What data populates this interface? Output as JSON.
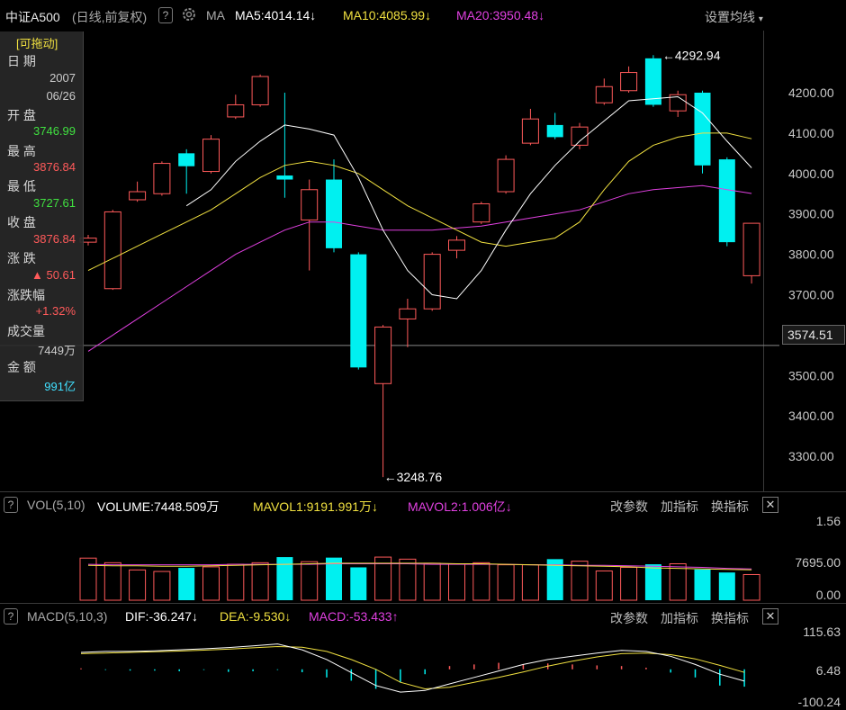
{
  "header": {
    "title": "中证A500",
    "period": "(日线,前复权)",
    "help": "?",
    "ma_label": "MA",
    "ma5": "MA5:4014.14",
    "ma10": "MA10:4085.99",
    "ma20": "MA20:3950.48",
    "settings": "设置均线",
    "colors": {
      "ma5": "#ffffff",
      "ma10": "#f0e040",
      "ma20": "#e040e0"
    }
  },
  "info_panel": {
    "drag": "[可拖动]",
    "date_label": "日 期",
    "year": "2007",
    "date": "06/26",
    "open_label": "开 盘",
    "open": "3746.99",
    "high_label": "最 高",
    "high": "3876.84",
    "low_label": "最 低",
    "low": "3727.61",
    "close_label": "收 盘",
    "close": "3876.84",
    "change_label": "涨 跌",
    "change": "▲ 50.61",
    "pct_label": "涨跌幅",
    "pct": "+1.32%",
    "volume_label": "成交量",
    "volume": "7449万",
    "amount_label": "金 额",
    "amount": "991亿"
  },
  "price_axis": [
    "4200.00",
    "4100.00",
    "4000.00",
    "3900.00",
    "3800.00",
    "3700.00",
    "3500.00",
    "3400.00",
    "3300.00"
  ],
  "crosshair_price": "3574.51",
  "high_marker": "4292.94",
  "low_marker": "3248.76",
  "vol_panel": {
    "name": "VOL(5,10)",
    "volume": "VOLUME:7448.509万",
    "mavol1": "MAVOL1:9191.991万",
    "mavol2": "MAVOL2:1.006亿",
    "axis": [
      "1.56",
      "7695.00",
      "0.00"
    ]
  },
  "macd_panel": {
    "name": "MACD(5,10,3)",
    "dif": "DIF:-36.247",
    "dea": "DEA:-9.530",
    "macd": "MACD:-53.433",
    "axis": [
      "115.63",
      "6.48",
      "-100.24"
    ]
  },
  "panel_buttons": {
    "params": "改参数",
    "add": "加指标",
    "swap": "换指标",
    "close": "✕"
  },
  "arrows": {
    "down": "↓",
    "up": "↑"
  },
  "colors": {
    "up": "#ff5a5a",
    "down": "#00f0f0",
    "dif": "#ffffff",
    "dea": "#f0e040",
    "macd": "#e040e0"
  },
  "chart_data": {
    "type": "candlestick",
    "candles": [
      {
        "o": 3830,
        "c": 3840,
        "h": 3848,
        "l": 3822
      },
      {
        "o": 3715,
        "c": 3905,
        "h": 3910,
        "l": 3712
      },
      {
        "o": 3935,
        "c": 3955,
        "h": 3980,
        "l": 3930
      },
      {
        "o": 3950,
        "c": 4025,
        "h": 4030,
        "l": 3945
      },
      {
        "o": 4050,
        "c": 4018,
        "h": 4060,
        "l": 3950
      },
      {
        "o": 4005,
        "c": 4085,
        "h": 4095,
        "l": 4000
      },
      {
        "o": 4140,
        "c": 4170,
        "h": 4195,
        "l": 4135
      },
      {
        "o": 4170,
        "c": 4240,
        "h": 4245,
        "l": 4165
      },
      {
        "o": 3995,
        "c": 3985,
        "h": 4200,
        "l": 3940
      },
      {
        "o": 3885,
        "c": 3960,
        "h": 3985,
        "l": 3760
      },
      {
        "o": 3985,
        "c": 3815,
        "h": 4035,
        "l": 3805
      },
      {
        "o": 3800,
        "c": 3520,
        "h": 3805,
        "l": 3515
      },
      {
        "o": 3480,
        "c": 3620,
        "h": 3625,
        "l": 3248.76
      },
      {
        "o": 3640,
        "c": 3665,
        "h": 3690,
        "l": 3570
      },
      {
        "o": 3665,
        "c": 3800,
        "h": 3805,
        "l": 3660
      },
      {
        "o": 3810,
        "c": 3835,
        "h": 3845,
        "l": 3790
      },
      {
        "o": 3880,
        "c": 3925,
        "h": 3930,
        "l": 3875
      },
      {
        "o": 3955,
        "c": 4035,
        "h": 4045,
        "l": 3950
      },
      {
        "o": 4075,
        "c": 4135,
        "h": 4160,
        "l": 4070
      },
      {
        "o": 4120,
        "c": 4090,
        "h": 4150,
        "l": 4085
      },
      {
        "o": 4070,
        "c": 4115,
        "h": 4125,
        "l": 4060
      },
      {
        "o": 4175,
        "c": 4215,
        "h": 4235,
        "l": 4170
      },
      {
        "o": 4205,
        "c": 4250,
        "h": 4265,
        "l": 4200
      },
      {
        "o": 4285,
        "c": 4170,
        "h": 4292.94,
        "l": 4165
      },
      {
        "o": 4155,
        "c": 4195,
        "h": 4205,
        "l": 4140
      },
      {
        "o": 4200,
        "c": 4020,
        "h": 4205,
        "l": 4000
      },
      {
        "o": 4035,
        "c": 3830,
        "h": 4040,
        "l": 3820
      },
      {
        "o": 3746.99,
        "c": 3876.84,
        "h": 3876.84,
        "l": 3727.61
      }
    ],
    "ma5": [
      null,
      null,
      null,
      null,
      3920,
      3960,
      4030,
      4080,
      4120,
      4110,
      4095,
      3990,
      3860,
      3760,
      3700,
      3690,
      3760,
      3860,
      3950,
      4020,
      4080,
      4130,
      4180,
      4185,
      4190,
      4150,
      4080,
      4014.14
    ],
    "ma10": [
      3760,
      3790,
      3820,
      3850,
      3880,
      3910,
      3950,
      3990,
      4020,
      4030,
      4020,
      4000,
      3960,
      3920,
      3890,
      3860,
      3830,
      3820,
      3830,
      3840,
      3880,
      3960,
      4030,
      4070,
      4090,
      4100,
      4100,
      4085.99
    ],
    "ma20": [
      3560,
      3600,
      3640,
      3680,
      3720,
      3760,
      3800,
      3830,
      3860,
      3880,
      3880,
      3870,
      3860,
      3860,
      3860,
      3865,
      3870,
      3880,
      3890,
      3900,
      3910,
      3930,
      3950,
      3960,
      3965,
      3970,
      3960,
      3950.48
    ],
    "volume": [
      0.82,
      0.73,
      0.59,
      0.56,
      0.63,
      0.65,
      0.7,
      0.73,
      0.84,
      0.75,
      0.83,
      0.64,
      0.84,
      0.8,
      0.72,
      0.71,
      0.73,
      0.69,
      0.69,
      0.8,
      0.76,
      0.57,
      0.64,
      0.7,
      0.71,
      0.6,
      0.54,
      0.5
    ],
    "mavol1": [
      0.68,
      0.67,
      0.67,
      0.66,
      0.66,
      0.67,
      0.68,
      0.69,
      0.7,
      0.71,
      0.72,
      0.72,
      0.72,
      0.72,
      0.72,
      0.71,
      0.71,
      0.7,
      0.69,
      0.68,
      0.67,
      0.66,
      0.65,
      0.63,
      0.62,
      0.61,
      0.6,
      0.59
    ],
    "mavol2": [
      0.7,
      0.69,
      0.69,
      0.69,
      0.69,
      0.69,
      0.7,
      0.7,
      0.7,
      0.7,
      0.71,
      0.71,
      0.71,
      0.71,
      0.7,
      0.7,
      0.7,
      0.7,
      0.69,
      0.69,
      0.68,
      0.68,
      0.67,
      0.66,
      0.65,
      0.64,
      0.62,
      0.61
    ],
    "vol_ylim": [
      0,
      1.56
    ],
    "dif": [
      52,
      55,
      55,
      57,
      60,
      63,
      67,
      72,
      78,
      60,
      30,
      -10,
      -50,
      -70,
      -65,
      -45,
      -25,
      -5,
      15,
      30,
      40,
      50,
      58,
      55,
      40,
      15,
      -15,
      -36.247
    ],
    "dea": [
      48,
      50,
      52,
      54,
      56,
      59,
      62,
      66,
      70,
      68,
      55,
      30,
      0,
      -40,
      -60,
      -55,
      -40,
      -25,
      -8,
      10,
      25,
      38,
      48,
      50,
      45,
      32,
      12,
      -9.53
    ],
    "macd": [
      3,
      -2,
      -4,
      -4,
      -6,
      -2,
      -8,
      -6,
      -2,
      -9,
      -25,
      -35,
      -60,
      -40,
      -15,
      10,
      15,
      20,
      15,
      18,
      15,
      12,
      10,
      5,
      -10,
      -25,
      -50,
      -53.433
    ],
    "macd_ylim": [
      -100.24,
      115.63
    ],
    "ylim": [
      3200,
      4350
    ]
  }
}
